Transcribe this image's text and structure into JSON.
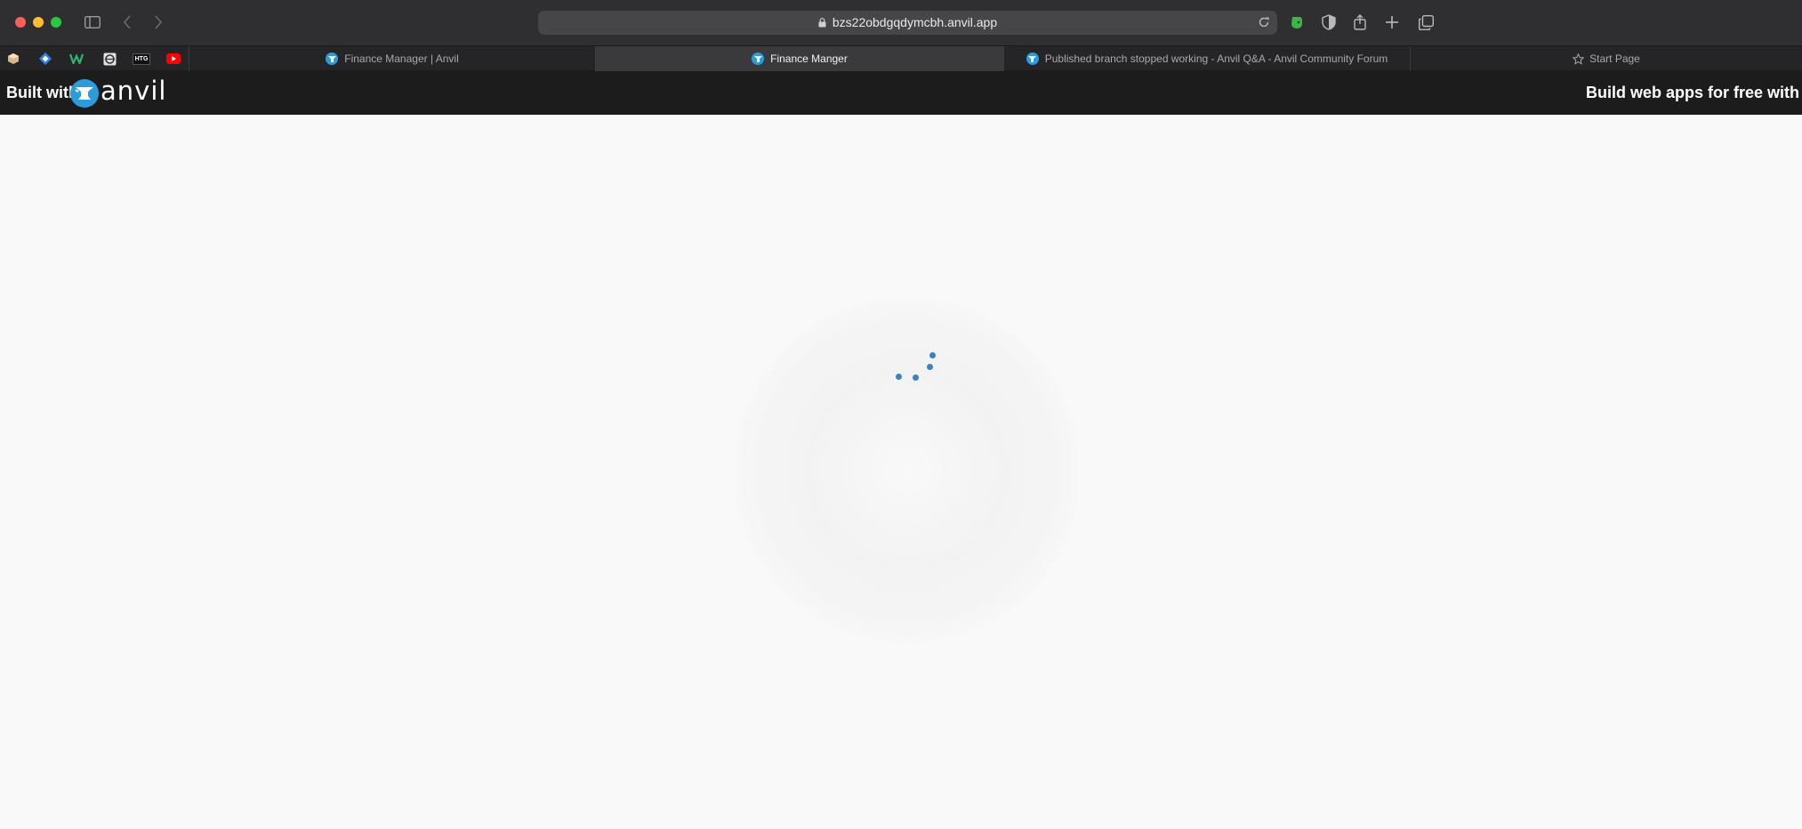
{
  "browser": {
    "url": "bzs22obdgqdymcbh.anvil.app",
    "pinned_tabs": [
      {
        "name": "pinned-tab-1-icon"
      },
      {
        "name": "pinned-tab-2-icon"
      },
      {
        "name": "pinned-tab-3-icon"
      },
      {
        "name": "pinned-tab-4-icon"
      },
      {
        "name": "pinned-tab-5-icon",
        "label": "HTG"
      },
      {
        "name": "youtube-icon"
      }
    ],
    "tabs": [
      {
        "label": "Finance Manager | Anvil",
        "active": false
      },
      {
        "label": "Finance Manger",
        "active": true
      },
      {
        "label": "Published branch stopped working - Anvil Q&A - Anvil Community Forum",
        "active": false
      },
      {
        "label": "Start Page",
        "active": false
      }
    ]
  },
  "banner": {
    "built_with": "Built with",
    "logo_word": "anvil",
    "promo": "Build web apps for free with Anvil"
  },
  "colors": {
    "anvil_blue": "#2d9cdb",
    "spinner_blue": "#3a82c4",
    "banner_bg": "#1c1c1c"
  }
}
